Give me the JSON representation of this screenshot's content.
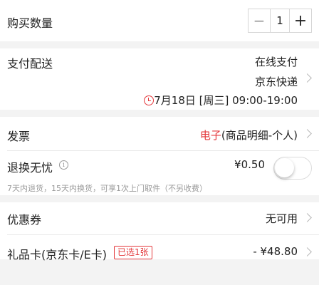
{
  "quantity": {
    "label": "购买数量",
    "minus_icon": "minus-icon",
    "plus_icon": "plus-icon",
    "value": "1"
  },
  "payment_delivery": {
    "label": "支付配送",
    "payment": "在线支付",
    "courier": "京东快递",
    "time_icon": "clock-icon",
    "time": "7月18日 [周三] 09:00-19:00"
  },
  "invoice": {
    "label": "发票",
    "type": "电子",
    "detail": "(商品明细-个人)"
  },
  "return": {
    "label": "退换无忧",
    "info_icon": "info-icon",
    "price": "¥0.50",
    "description": "7天内退货，15天内换货，可享1次上门取件（不另收费）",
    "toggle_on": false
  },
  "coupon": {
    "label": "优惠券",
    "status": "无可用"
  },
  "gift_card": {
    "label": "礼品卡(京东卡/E卡)",
    "badge": "已选1张",
    "amount": "- ¥48.80"
  },
  "colors": {
    "accent": "#e4393c",
    "background": "#f3f3f3",
    "muted": "#999999"
  }
}
